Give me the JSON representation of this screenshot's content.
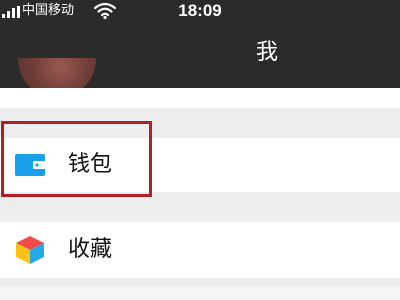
{
  "status_bar": {
    "carrier": "中国移动",
    "time": "18:09",
    "signal_icon": "signal-bars-icon",
    "wifi_icon": "wifi-icon"
  },
  "nav": {
    "title": "我"
  },
  "menu": {
    "items": [
      {
        "label": "钱包",
        "icon": "wallet-icon",
        "highlighted": true
      },
      {
        "label": "收藏",
        "icon": "favorites-cube-icon",
        "highlighted": false
      }
    ]
  },
  "colors": {
    "nav_background": "#2b2b2b",
    "page_background": "#ededed",
    "wallet_icon": "#1aa0ea",
    "highlight_border": "#b41f24"
  }
}
